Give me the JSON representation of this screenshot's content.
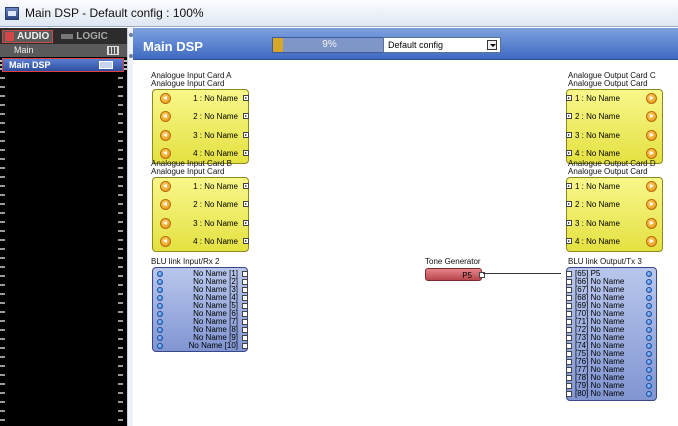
{
  "window": {
    "title": "Main DSP - Default config : 100%"
  },
  "sidebar": {
    "tabs": [
      {
        "label": "AUDIO"
      },
      {
        "label": "LOGIC"
      }
    ],
    "tree_item": "Main",
    "selected_device": "Main DSP"
  },
  "header": {
    "title": "Main DSP",
    "cpu_usage": {
      "percent": 9,
      "label": "9%"
    },
    "config_select": {
      "value": "Default config"
    }
  },
  "canvas": {
    "input_card_a": {
      "name": "Analogue Input Card A",
      "type": "Analogue Input Card",
      "ports": [
        "1 : No Name",
        "2 : No Name",
        "3 : No Name",
        "4 : No Name"
      ]
    },
    "input_card_b": {
      "name": "Analogue Input Card B",
      "type": "Analogue Input Card",
      "ports": [
        "1 : No Name",
        "2 : No Name",
        "3 : No Name",
        "4 : No Name"
      ]
    },
    "output_card_c": {
      "name": "Analogue Output Card C",
      "type": "Analogue Output Card",
      "ports": [
        "1 : No Name",
        "2 : No Name",
        "3 : No Name",
        "4 : No Name"
      ]
    },
    "output_card_d": {
      "name": "Analogue Output Card D",
      "type": "Analogue Output Card",
      "ports": [
        "1 : No Name",
        "2 : No Name",
        "3 : No Name",
        "4 : No Name"
      ]
    },
    "blu_input": {
      "name": "BLU link Input/Rx 2",
      "ports": [
        "No Name [1]",
        "No Name [2]",
        "No Name [3]",
        "No Name [4]",
        "No Name [5]",
        "No Name [6]",
        "No Name [7]",
        "No Name [8]",
        "No Name [9]",
        "No Name [10]"
      ]
    },
    "tone_generator": {
      "name": "Tone Generator",
      "label": "P5"
    },
    "blu_output": {
      "name": "BLU link Output/Tx 3",
      "ports": [
        "[65] P5",
        "[66] No Name",
        "[67] No Name",
        "[68] No Name",
        "[69] No Name",
        "[70] No Name",
        "[71] No Name",
        "[72] No Name",
        "[73] No Name",
        "[74] No Name",
        "[75] No Name",
        "[76] No Name",
        "[77] No Name",
        "[78] No Name",
        "[79] No Name",
        "[80] No Name"
      ]
    }
  },
  "colors": {
    "header_blue": "#4f77c9",
    "input_yellow": "#eeec5e",
    "blu_blue": "#9aabe0",
    "tone_red": "#cc6268",
    "cpu_fill": "#d8a628"
  }
}
